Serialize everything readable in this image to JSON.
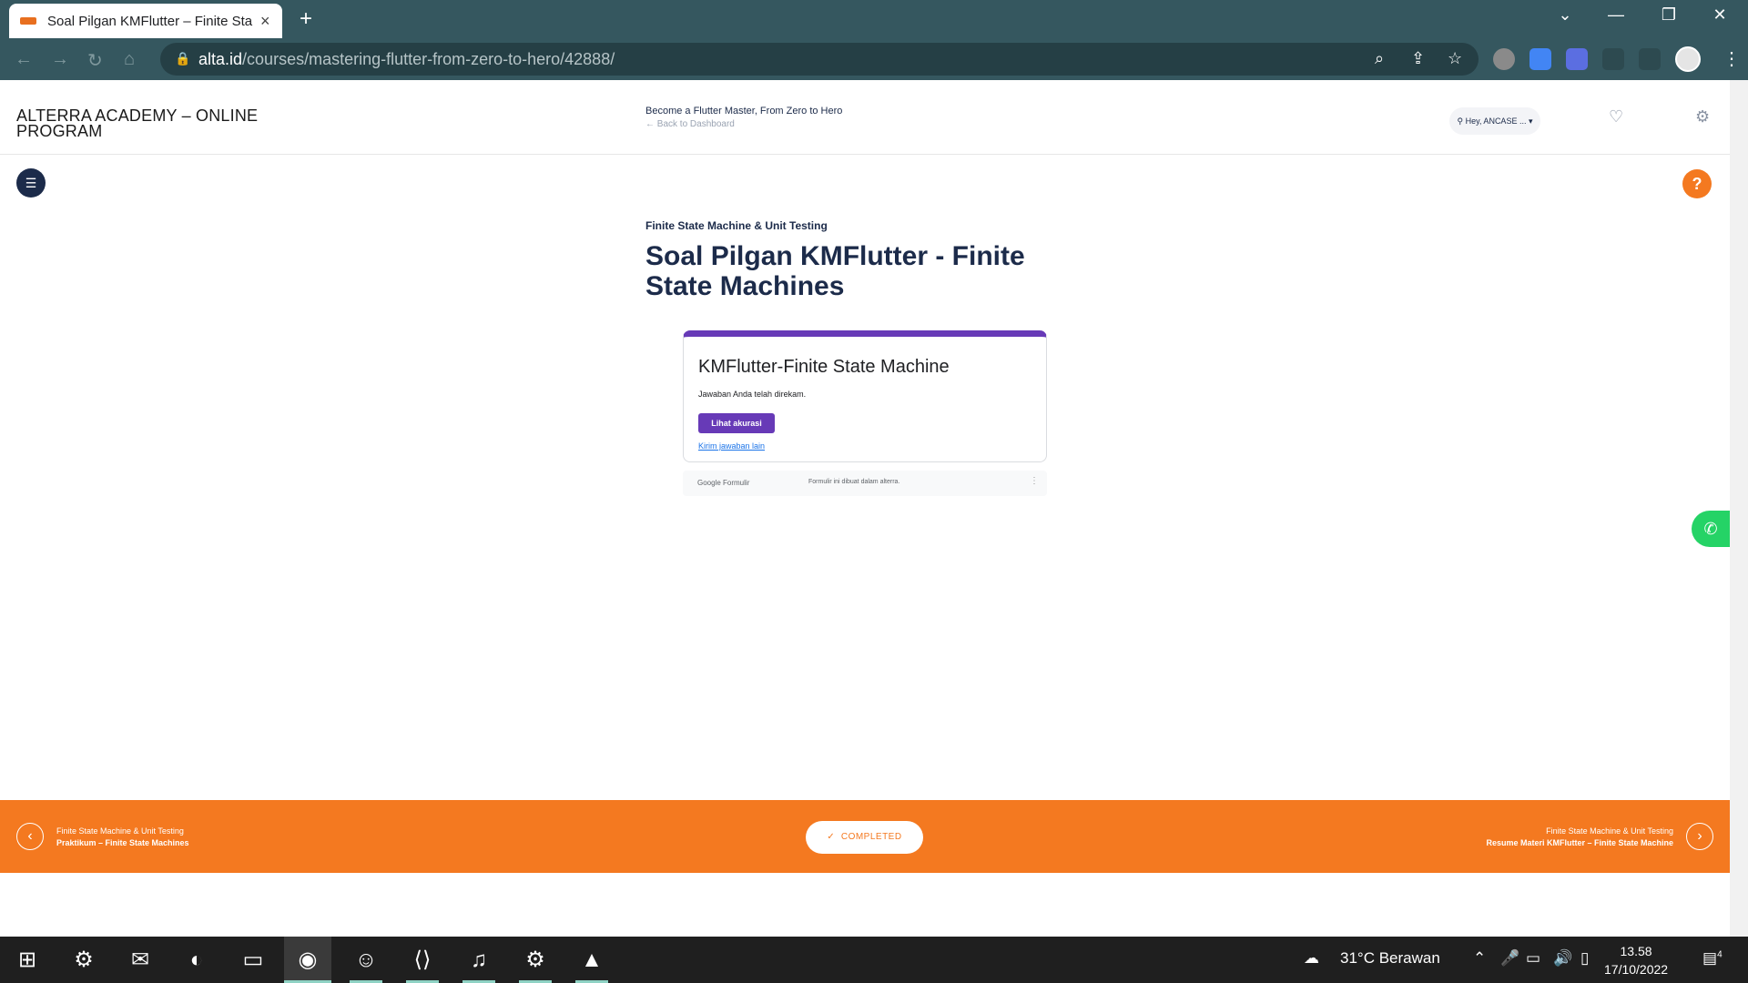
{
  "browser": {
    "tab_title": "Soal Pilgan KMFlutter – Finite Sta",
    "url_domain": "alta.id",
    "url_path": "/courses/mastering-flutter-from-zero-to-hero/42888/"
  },
  "site": {
    "brand": "ALTERRA ACADEMY – ONLINE PROGRAM",
    "course_title": "Become a Flutter Master, From Zero to Hero",
    "back_link": "Back to Dashboard",
    "user_greeting": "Hey, ANCASE ..."
  },
  "lesson": {
    "category": "Finite State Machine & Unit Testing",
    "title": "Soal Pilgan KMFlutter - Finite State Machines"
  },
  "form": {
    "title": "KMFlutter-Finite State Machine",
    "message": "Jawaban Anda telah direkam.",
    "view_button": "Lihat akurasi",
    "resend_link": "Kirim jawaban lain",
    "brand": "Google Formulir",
    "note": "Formulir ini dibuat dalam alterra."
  },
  "lesson_nav": {
    "prev_category": "Finite State Machine & Unit Testing",
    "prev_title": "Praktikum – Finite State Machines",
    "status": "COMPLETED",
    "next_category": "Finite State Machine & Unit Testing",
    "next_title": "Resume Materi KMFlutter – Finite State Machine"
  },
  "taskbar": {
    "weather": "31°C  Berawan",
    "time": "13.58",
    "date": "17/10/2022",
    "notifications": "4"
  },
  "colors": {
    "primary_orange": "#f47920",
    "navy": "#1c2b4a",
    "form_purple": "#673ab7",
    "whatsapp": "#25d366"
  }
}
